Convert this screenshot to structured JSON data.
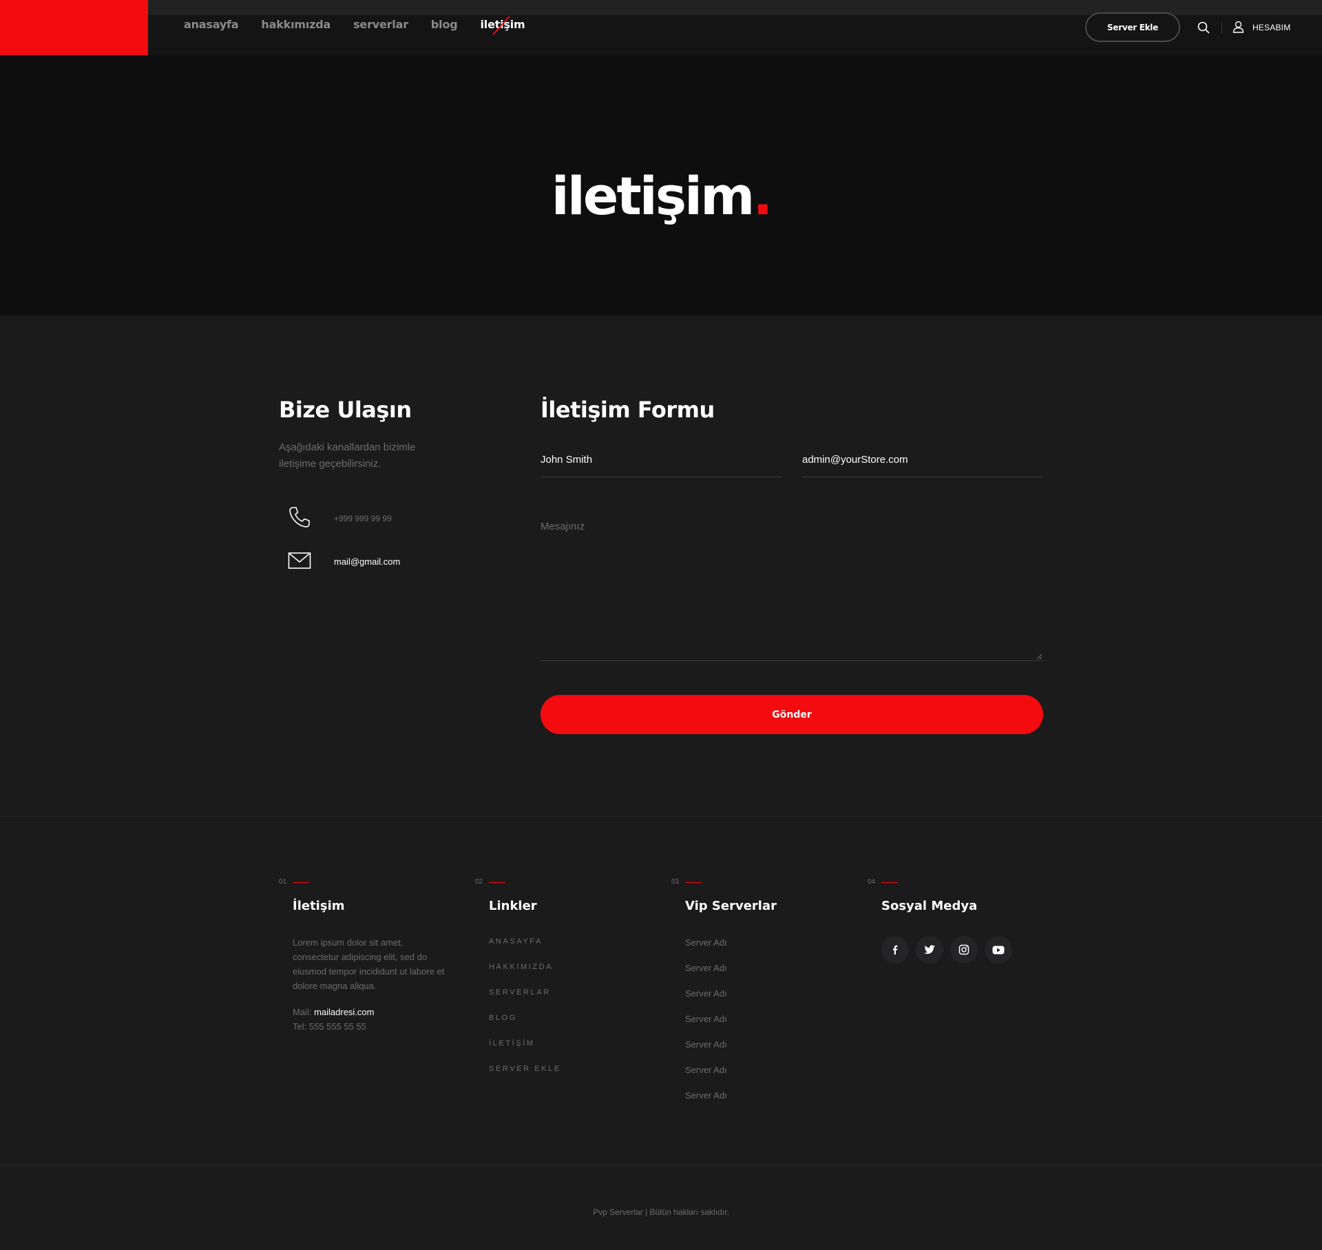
{
  "header": {
    "nav": [
      "anasayfa",
      "hakkımızda",
      "serverlar",
      "blog",
      "iletişim"
    ],
    "active_nav": "iletişim",
    "server_button": "Server Ekle",
    "account": "HESABIM"
  },
  "hero": {
    "title": "iletişim",
    "dot": "."
  },
  "contact": {
    "title": "Bize Ulaşın",
    "desc": "Aşağıdaki kanallardan bizimle iletişime geçebilirsiniz.",
    "phone": "+999 999 99 99",
    "email": "mail@gmail.com"
  },
  "form": {
    "title": "İletişim Formu",
    "name_value": "John Smith",
    "email_value": "admin@yourStore.com",
    "message_placeholder": "Mesajınız",
    "submit": "Gönder"
  },
  "footer": {
    "col1": {
      "num": "01",
      "title": "İletişim",
      "text": "Lorem ipsum dolor sit amet, consectetur adipiscing elit, sed do eiusmod tempor incididunt ut labore et dolore magna aliqua.",
      "mail_label": "Mail:",
      "mail": "mailadresi.com",
      "tel": "Tel: 555 555 55 55"
    },
    "col2": {
      "num": "02",
      "title": "Linkler",
      "links": [
        "ANASAYFA",
        "HAKKIMIZDA",
        "SERVERLAR",
        "BLOG",
        "İLETİŞİM",
        "SERVER EKLE"
      ]
    },
    "col3": {
      "num": "03",
      "title": "Vip Serverlar",
      "items": [
        "Server Adı",
        "Server Adı",
        "Server Adı",
        "Server Adı",
        "Server Adı",
        "Server Adı",
        "Server Adı"
      ]
    },
    "col4": {
      "num": "04",
      "title": "Sosyal Medya",
      "icons": [
        "facebook-icon",
        "twitter-icon",
        "instagram-icon",
        "youtube-icon"
      ]
    },
    "copyright": "Pvp Serverlar  |  Bütün hakları saklıdır."
  },
  "colors": {
    "accent": "#f30b10",
    "hero_bg": "#0e0e0f",
    "page_bg": "#1b1b1c"
  }
}
